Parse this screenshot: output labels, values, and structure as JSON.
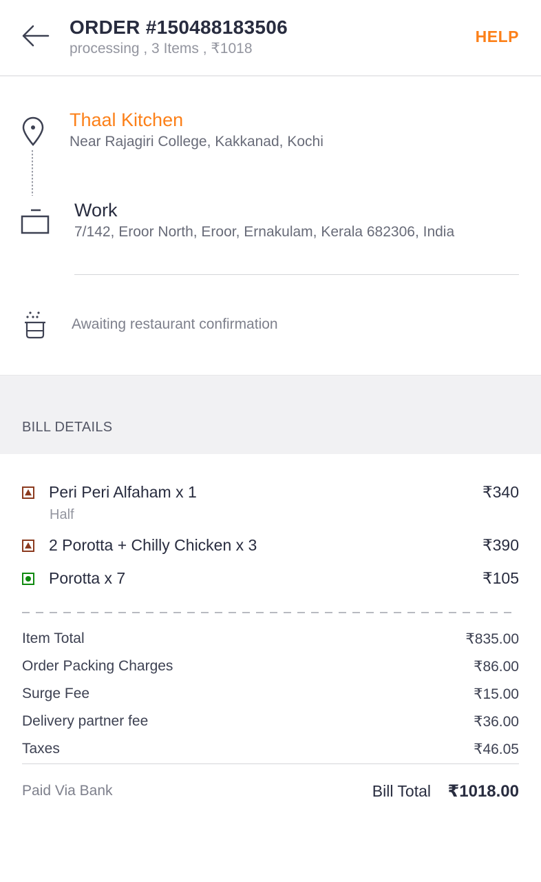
{
  "header": {
    "back_icon": "arrow-left-icon",
    "order_title": "ORDER #150488183506",
    "order_sub": "processing , 3 Items , ₹1018",
    "help_label": "HELP"
  },
  "tracking": {
    "restaurant_name": "Thaal Kitchen",
    "restaurant_address": "Near Rajagiri College, Kakkanad, Kochi",
    "delivery_label": "Work",
    "delivery_address": "7/142, Eroor North, Eroor, Ernakulam, Kerala 682306, India",
    "status_text": "Awaiting restaurant confirmation"
  },
  "bill": {
    "title": "BILL DETAILS",
    "items": [
      {
        "name": "Peri Peri Alfaham x 1",
        "variant": "Half",
        "price": "₹340",
        "type": "non-veg"
      },
      {
        "name": "2 Porotta + Chilly Chicken x 3",
        "variant": "",
        "price": "₹390",
        "type": "non-veg"
      },
      {
        "name": "Porotta x 7",
        "variant": "",
        "price": "₹105",
        "type": "veg"
      }
    ],
    "charges": [
      {
        "label": "Item Total",
        "value": "₹835.00"
      },
      {
        "label": "Order Packing Charges",
        "value": "₹86.00"
      },
      {
        "label": "Surge Fee",
        "value": "₹15.00"
      },
      {
        "label": "Delivery partner fee",
        "value": "₹36.00"
      },
      {
        "label": "Taxes",
        "value": "₹46.05"
      }
    ],
    "paid_via": "Paid Via Bank",
    "total_label": "Bill Total",
    "total_value": "₹1018.00"
  },
  "colors": {
    "accent": "#fc8019",
    "nonveg": "#8b3a1e",
    "veg": "#0f8a0f"
  }
}
